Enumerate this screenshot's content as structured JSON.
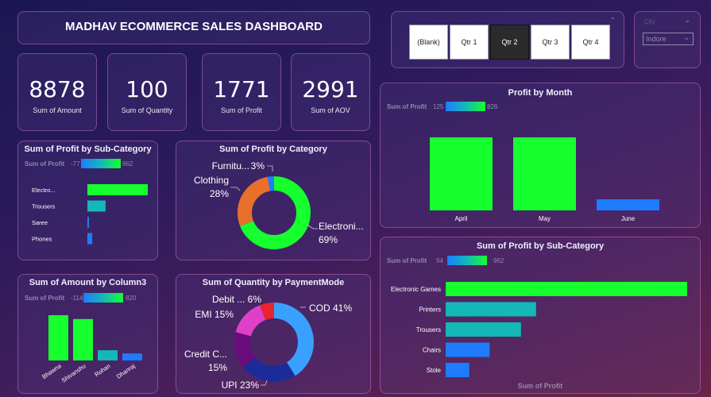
{
  "header": {
    "title": "MADHAV ECOMMERCE SALES DASHBOARD"
  },
  "kpis": [
    {
      "value": "8878",
      "label": "Sum of Amount"
    },
    {
      "value": "100",
      "label": "Sum of Quantity"
    },
    {
      "value": "1771",
      "label": "Sum of Profit"
    },
    {
      "value": "2991",
      "label": "Sum of AOV"
    }
  ],
  "quarter_slicer": {
    "buttons": [
      "(Blank)",
      "Qtr 1",
      "Qtr 2",
      "Qtr 3",
      "Qtr 4"
    ],
    "selected": "Qtr 2"
  },
  "city_slicer": {
    "label": "City",
    "selected": "Indore"
  },
  "colors": {
    "green": "#16ff2e",
    "teal": "#14b8b8",
    "blue": "#1e7cff",
    "orange": "#e8702a",
    "navy": "#1b2b9a",
    "purple": "#6a0d7a",
    "magenta": "#e040c8",
    "red": "#e6252d",
    "light_blue": "#3aa0ff"
  },
  "charts": {
    "profit_subcat_small": {
      "title": "Sum of Profit by Sub-Category",
      "legend": {
        "label": "Sum of Profit",
        "min": "-77",
        "max": "962"
      }
    },
    "profit_category": {
      "title": "Sum of Profit by Category"
    },
    "amount_column3": {
      "title": "Sum of Amount by Column3",
      "legend": {
        "label": "Sum of Profit",
        "min": "-114",
        "max": "820"
      }
    },
    "quantity_payment": {
      "title": "Sum of Quantity by PaymentMode"
    },
    "profit_month": {
      "title": "Profit by Month",
      "legend": {
        "label": "Sum of Profit",
        "min": "125",
        "max": "826"
      }
    },
    "profit_subcat_large": {
      "title": "Sum of Profit by Sub-Category",
      "legend": {
        "label": "Sum of Profit",
        "min": "94",
        "max": "962"
      },
      "xlabel": "Sum of Profit"
    }
  },
  "chart_data": [
    {
      "type": "bar",
      "orientation": "horizontal",
      "title": "Sum of Profit by Sub-Category",
      "categories": [
        "Electro...",
        "Trousers",
        "Saree",
        "Phones"
      ],
      "values": [
        962,
        290,
        20,
        77
      ],
      "colors": [
        "#16ff2e",
        "#14b8b8",
        "#1e7cff",
        "#1e7cff"
      ]
    },
    {
      "type": "pie",
      "title": "Sum of Profit by Category",
      "labels": [
        "Electronics",
        "Clothing",
        "Furniture"
      ],
      "display_labels": [
        "Electroni...",
        "Clothing",
        "Furnitu..."
      ],
      "values": [
        69,
        28,
        3
      ],
      "value_labels": [
        "69%",
        "28%",
        "3%"
      ],
      "colors": [
        "#16ff2e",
        "#e8702a",
        "#1e7cff"
      ]
    },
    {
      "type": "bar",
      "title": "Sum of Amount by Column3",
      "categories": [
        "Bhawna",
        "Shivanshu",
        "Rohan",
        "Dhanraj"
      ],
      "values": [
        1420,
        1300,
        320,
        220
      ],
      "colors": [
        "#16ff2e",
        "#16ff2e",
        "#14b8b8",
        "#1e7cff"
      ]
    },
    {
      "type": "pie",
      "title": "Sum of Quantity by PaymentMode",
      "labels": [
        "COD",
        "UPI",
        "Credit Card",
        "EMI",
        "Debit Card"
      ],
      "display_labels": [
        "COD 41%",
        "UPI 23%",
        "Credit C...",
        "EMI 15%",
        "Debit ... 6%"
      ],
      "second_lines": [
        "",
        "",
        "15%",
        "",
        ""
      ],
      "values": [
        41,
        23,
        15,
        15,
        6
      ],
      "colors": [
        "#3aa0ff",
        "#1b2b9a",
        "#6a0d7a",
        "#e040c8",
        "#e6252d"
      ]
    },
    {
      "type": "bar",
      "title": "Profit by Month",
      "categories": [
        "April",
        "May",
        "June"
      ],
      "values": [
        826,
        826,
        125
      ],
      "colors": [
        "#16ff2e",
        "#16ff2e",
        "#1e7cff"
      ]
    },
    {
      "type": "bar",
      "orientation": "horizontal",
      "title": "Sum of Profit by Sub-Category",
      "categories": [
        "Electronic Games",
        "Printers",
        "Trousers",
        "Chairs",
        "Stole"
      ],
      "values": [
        962,
        360,
        300,
        175,
        94
      ],
      "colors": [
        "#16ff2e",
        "#14b8b8",
        "#14b8b8",
        "#1e7cff",
        "#1e7cff"
      ],
      "xlabel": "Sum of Profit"
    }
  ]
}
